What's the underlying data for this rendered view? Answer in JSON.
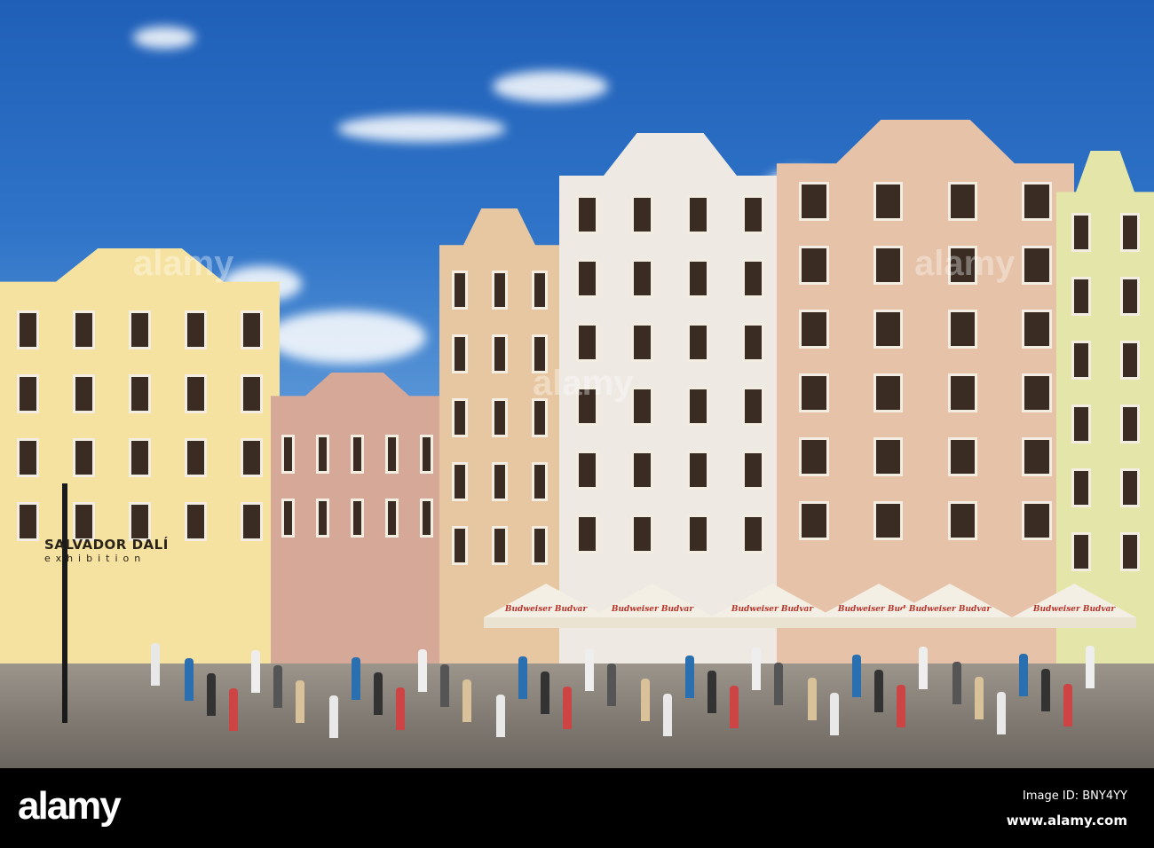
{
  "scene": {
    "sky_color": "#2f74c8",
    "buildings": [
      {
        "color": "#f6e2a0"
      },
      {
        "color": "#d6a898"
      },
      {
        "color": "#e7c7a2"
      },
      {
        "color": "#efe9e4"
      },
      {
        "color": "#e6c2a8"
      },
      {
        "color": "#e3e6a8"
      }
    ],
    "sign": {
      "line1": "SALVADOR DALÍ",
      "line2": "exhibition"
    },
    "umbrella_brand": "Budweiser Budvar"
  },
  "watermark": {
    "text": "alamy"
  },
  "footer": {
    "logo": "alamy",
    "image_id": "Image ID: BNY4YY",
    "url": "www.alamy.com"
  }
}
